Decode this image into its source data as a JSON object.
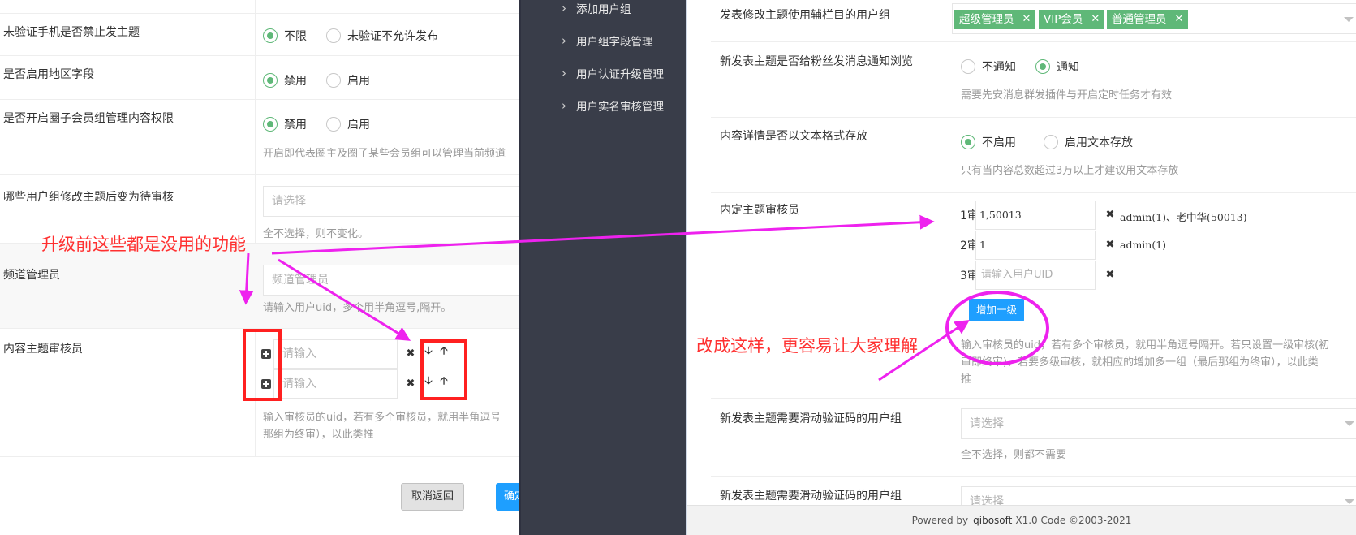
{
  "left": {
    "row_unverified_phone": {
      "label": "未验证手机是否禁止发主题",
      "opt1": "不限",
      "opt2": "未验证不允许发布",
      "selected": "不限"
    },
    "row_region": {
      "label": "是否启用地区字段",
      "opt1": "禁用",
      "opt2": "启用",
      "selected": "禁用"
    },
    "row_circle": {
      "label": "是否开启圈子会员组管理内容权限",
      "opt1": "禁用",
      "opt2": "启用",
      "selected": "禁用",
      "help": "开启即代表圈主及圈子某些会员组可以管理当前频道"
    },
    "row_edit_pending": {
      "label": "哪些用户组修改主题后变为待审核",
      "placeholder": "请选择",
      "help": "全不选择，则不变化。"
    },
    "row_channel_admin": {
      "label": "频道管理员",
      "placeholder": "频道管理员",
      "help": "请输入用户uid，多个用半角逗号,隔开。"
    },
    "row_auditor": {
      "label": "内容主题审核员",
      "input1_placeholder": "请输入",
      "input2_placeholder": "请输入",
      "help1": "输入审核员的uid，若有多个审核员，就用半角逗号",
      "help2": "那组为终审），以此类推"
    },
    "cancel_label": "取消返回",
    "confirm_label": "确定"
  },
  "annotations": {
    "left_note": "升级前这些都是没用的功能",
    "right_note": "改成这样，更容易让大家理解"
  },
  "nav": {
    "items": [
      {
        "label": "添加用户组"
      },
      {
        "label": "用户组字段管理"
      },
      {
        "label": "用户认证升级管理"
      },
      {
        "label": "用户实名审核管理"
      }
    ]
  },
  "right": {
    "row_groups": {
      "label": "发表修改主题使用辅栏目的用户组",
      "tags": [
        "超级管理员",
        "VIP会员",
        "普通管理员"
      ]
    },
    "row_notify": {
      "label": "新发表主题是否给粉丝发消息通知浏览",
      "opt1": "不通知",
      "opt2": "通知",
      "selected": "通知",
      "help": "需要先安消息群发插件与开启定时任务才有效"
    },
    "row_text_store": {
      "label": "内容详情是否以文本格式存放",
      "opt1": "不启用",
      "opt2": "启用文本存放",
      "selected": "不启用",
      "help": "只有当内容总数超过3万以上才建议用文本存放"
    },
    "row_audit": {
      "label": "内定主题审核员",
      "levels": [
        {
          "name": "1审",
          "value": "1,50013",
          "names": "admin(1)、老中华(50013)"
        },
        {
          "name": "2审",
          "value": "1",
          "names": "admin(1)"
        },
        {
          "name": "3审",
          "placeholder": "请输入用户UID"
        }
      ],
      "add_level_label": "增加一级",
      "help1": "输入审核员的uid，若有多个审核员，就用半角逗号隔开。若只设置一级审核(初",
      "help2": "审即终审)，若要多级审核，就相应的增加多一组（最后那组为终审），以此类",
      "help3": "推"
    },
    "row_captcha1": {
      "label": "新发表主题需要滑动验证码的用户组",
      "placeholder": "请选择",
      "help": "全不选择，则都不需要"
    },
    "row_captcha2": {
      "label": "新发表主题需要滑动验证码的用户组",
      "placeholder": "请选择"
    },
    "footer": {
      "prefix": "Powered by",
      "brand": "qibosoft",
      "suffix": "X1.0 Code ©2003-2021"
    }
  },
  "colors": {
    "annotation_red": "#ff3030",
    "arrow_magenta": "#ee22ee",
    "accent_green": "#5fb878",
    "accent_blue": "#1e9fff",
    "nav_bg": "#393d49"
  }
}
